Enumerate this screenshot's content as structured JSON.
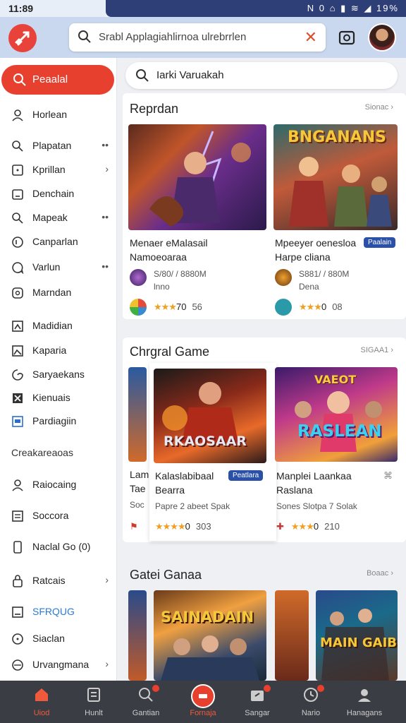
{
  "status": {
    "time": "11:89",
    "icons": "N 0 ⌂ ▮ ≋ ◢ 19%"
  },
  "header": {
    "search_value": "Srabl Applagiahlirnoa ulrebrrlen"
  },
  "sidebar": {
    "selected": "Peaalal",
    "items": [
      {
        "label": "Horlean",
        "trail": ""
      },
      {
        "label": "Plapatan",
        "trail": "••"
      },
      {
        "label": "Kprillan",
        "trail": "›"
      },
      {
        "label": "Denchain",
        "trail": ""
      },
      {
        "label": "Mapeak",
        "trail": "••"
      },
      {
        "label": "Canparlan",
        "trail": ""
      },
      {
        "label": "Varlun",
        "trail": "••"
      },
      {
        "label": "Marndan",
        "trail": ""
      },
      {
        "label": "Madidian",
        "trail": ""
      },
      {
        "label": "Kaparia",
        "trail": ""
      },
      {
        "label": "Saryaekans",
        "trail": ""
      },
      {
        "label": "Kienuais",
        "trail": ""
      },
      {
        "label": "Pardiagiin",
        "trail": ""
      }
    ],
    "section_label": "Creakareaoas",
    "items2": [
      {
        "label": "Raiocaing",
        "trail": ""
      },
      {
        "label": "Soccora",
        "trail": ""
      },
      {
        "label": "Naclal Go (0)",
        "trail": ""
      },
      {
        "label": "Ratcais",
        "trail": "›"
      },
      {
        "label": "SFRQUG",
        "trail": ""
      },
      {
        "label": "Siaclan",
        "trail": ""
      },
      {
        "label": "Urvangmana",
        "trail": "›"
      }
    ]
  },
  "main": {
    "search_value": "Iarki Varuakah",
    "sections": [
      {
        "title": "Reprdan",
        "more": "Sionac ›"
      },
      {
        "title": "Chrgral Game",
        "more": "SIGAA1 ›"
      },
      {
        "title": "Gatei Ganaa",
        "more": "Boaac ›"
      }
    ],
    "row1": [
      {
        "title": "Menaer eMalasail Namoeoaraa",
        "meta1": "S/80/ / 8880M",
        "meta2": "lnno",
        "stars": "★★★",
        "rating_text": "70",
        "count": "56",
        "badge": "",
        "art": ""
      },
      {
        "title": "Mpeeyer oenesloa Harpe cliana",
        "meta1": "S881/ / 880M",
        "meta2": "Dena",
        "stars": "★★★",
        "rating_text": "0",
        "count": "08",
        "badge": "Paalain",
        "art": "BNGANANS"
      }
    ],
    "row2": [
      {
        "title": "Kalaslabibaal Bearra",
        "meta": "Papre 2 abeet Spak",
        "stars": "★★★★",
        "rating_text": "0",
        "count": "303",
        "badge": "Peatlara",
        "art": "RKAOSAAR"
      },
      {
        "title": "Manplei Laankaa Raslana",
        "meta": "Sones Slotpa 7 Solak",
        "stars": "★★★",
        "rating_text": "0",
        "count": "210",
        "badge": "",
        "art": "RASLEAN",
        "art2": "VAEOT"
      }
    ],
    "row2_partial": {
      "title1": "Lam",
      "title2": "Tae",
      "meta": "Soc"
    },
    "row3": [
      {
        "art": "SAINADAIN"
      },
      {
        "art": "MAIN GAIB"
      }
    ]
  },
  "bottom_nav": [
    {
      "label": "Uiod",
      "active": true,
      "dot": false
    },
    {
      "label": "Hunlt",
      "active": false,
      "dot": false
    },
    {
      "label": "Gantian",
      "active": false,
      "dot": true
    },
    {
      "label": "Fornaja",
      "active": true,
      "dot": false
    },
    {
      "label": "Sangar",
      "active": false,
      "dot": true
    },
    {
      "label": "Nario",
      "active": false,
      "dot": true
    },
    {
      "label": "Hanagans",
      "active": false,
      "dot": false
    }
  ],
  "colors": {
    "accent": "#e8402e",
    "badge": "#2a50a8",
    "star": "#f0a020"
  }
}
